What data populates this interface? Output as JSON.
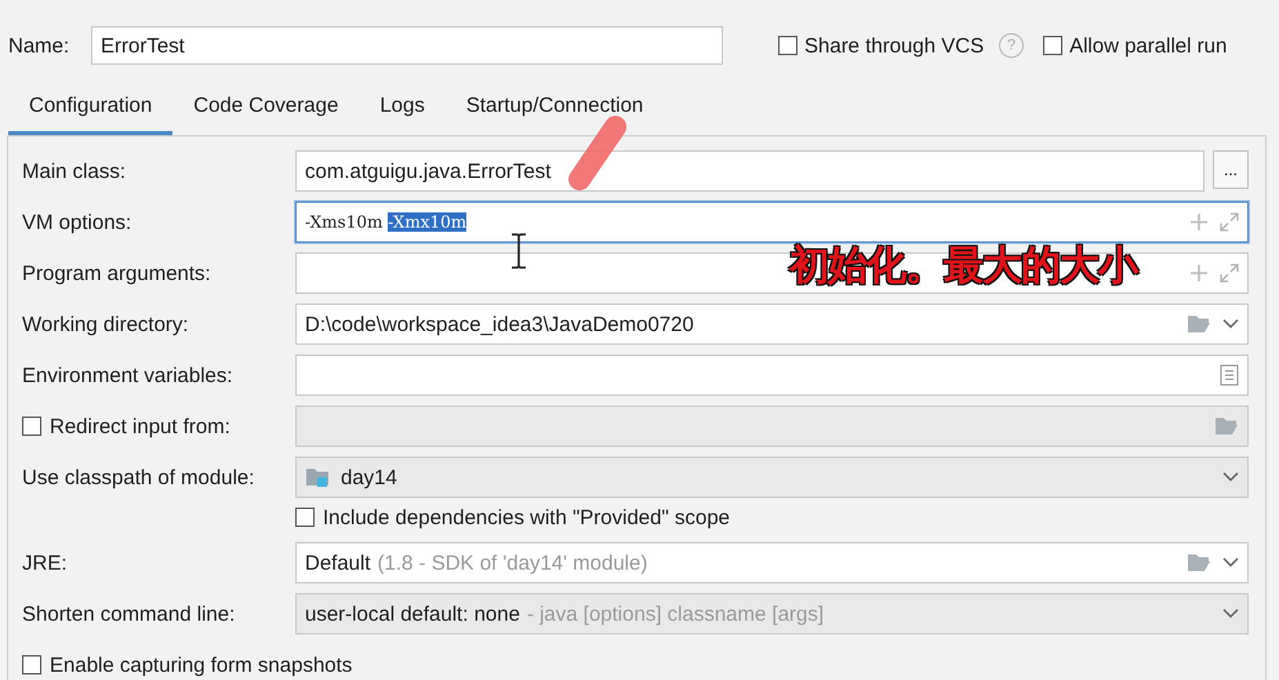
{
  "name_field": {
    "label": "Name:",
    "value": "ErrorTest"
  },
  "options": [
    {
      "label": "Share through VCS",
      "checked": false,
      "help": "?"
    },
    {
      "label": "Allow parallel run",
      "checked": false
    }
  ],
  "tabs": [
    {
      "label": "Configuration",
      "selected": true
    },
    {
      "label": "Code Coverage",
      "selected": false
    },
    {
      "label": "Logs",
      "selected": false
    },
    {
      "label": "Startup/Connection",
      "selected": false
    }
  ],
  "rows": [
    {
      "kind": "text_button",
      "label": "Main class:",
      "value": "com.atguigu.java.ErrorTest",
      "button": "..."
    },
    {
      "kind": "expandable",
      "label": "VM options:",
      "value": "-Xms10m ",
      "selection": "-Xmx10m",
      "focused": true
    },
    {
      "kind": "expandable",
      "label": "Program arguments:",
      "focused": false
    },
    {
      "kind": "browse_dropdown",
      "label": "Working directory:",
      "value": "D:\\code\\workspace_idea3\\JavaDemo0720"
    },
    {
      "kind": "list",
      "label": "Environment variables:"
    },
    {
      "kind": "browse_disabled",
      "label": "Redirect input from:",
      "checked": false
    },
    {
      "kind": "module_combo",
      "label": "Use classpath of module:",
      "value": "day14"
    },
    {
      "kind": "checkbox_only",
      "label": "Include dependencies with \"Provided\" scope",
      "checked": false
    },
    {
      "kind": "browse_dropdown",
      "label": "JRE:",
      "value": "Default",
      "hint": "(1.8 - SDK of 'day14' module)"
    },
    {
      "kind": "combo",
      "label": "Shorten command line:",
      "value": "user-local default: none",
      "hint": "- java [options] classname [args]"
    },
    {
      "kind": "checkbox_row",
      "label": "Enable capturing form snapshots",
      "checked": false
    }
  ],
  "annotation": {
    "text": "初始化。最大的大小"
  }
}
